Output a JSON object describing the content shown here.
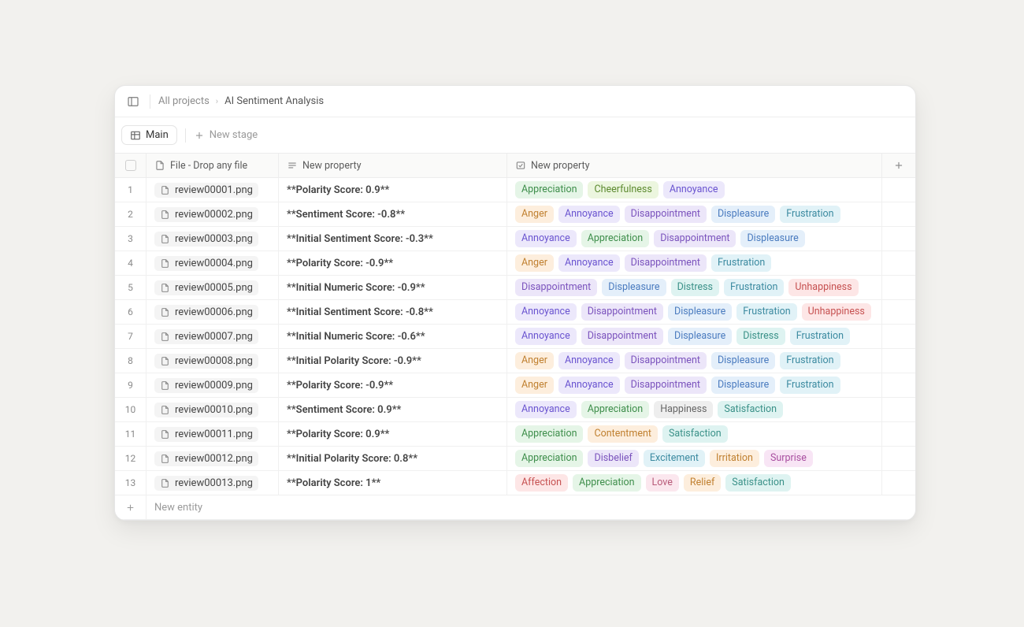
{
  "breadcrumbs": {
    "root": "All projects",
    "current": "AI Sentiment Analysis"
  },
  "stages": {
    "main_tab": "Main",
    "new_stage": "New stage"
  },
  "columns": {
    "file": "File - Drop any file",
    "prop1": "New property",
    "prop2": "New property"
  },
  "new_entity_label": "New entity",
  "tag_palette": {
    "Appreciation": "c-green",
    "Cheerfulness": "c-lime",
    "Annoyance": "c-purple",
    "Anger": "c-orange",
    "Disappointment": "c-violet",
    "Displeasure": "c-blue",
    "Frustration": "c-cyan",
    "Distress": "c-teal",
    "Unhappiness": "c-red",
    "Happiness": "c-gray",
    "Satisfaction": "c-teal",
    "Contentment": "c-orange",
    "Disbelief": "c-violet",
    "Excitement": "c-cyan",
    "Irritation": "c-orange",
    "Surprise": "c-magenta",
    "Affection": "c-red",
    "Love": "c-pink",
    "Relief": "c-orange"
  },
  "rows": [
    {
      "idx": 1,
      "file": "review00001.png",
      "score": "**Polarity Score: 0.9**",
      "tags": [
        "Appreciation",
        "Cheerfulness",
        "Annoyance"
      ]
    },
    {
      "idx": 2,
      "file": "review00002.png",
      "score": "**Sentiment Score: -0.8**",
      "tags": [
        "Anger",
        "Annoyance",
        "Disappointment",
        "Displeasure",
        "Frustration"
      ]
    },
    {
      "idx": 3,
      "file": "review00003.png",
      "score": "**Initial Sentiment Score: -0.3**",
      "tags": [
        "Annoyance",
        "Appreciation",
        "Disappointment",
        "Displeasure"
      ]
    },
    {
      "idx": 4,
      "file": "review00004.png",
      "score": "**Polarity Score: -0.9**",
      "tags": [
        "Anger",
        "Annoyance",
        "Disappointment",
        "Frustration"
      ]
    },
    {
      "idx": 5,
      "file": "review00005.png",
      "score": "**Initial Numeric Score: -0.9**",
      "tags": [
        "Disappointment",
        "Displeasure",
        "Distress",
        "Frustration",
        "Unhappiness"
      ]
    },
    {
      "idx": 6,
      "file": "review00006.png",
      "score": "**Initial Sentiment Score: -0.8**",
      "tags": [
        "Annoyance",
        "Disappointment",
        "Displeasure",
        "Frustration",
        "Unhappiness"
      ]
    },
    {
      "idx": 7,
      "file": "review00007.png",
      "score": "**Initial Numeric Score: -0.6**",
      "tags": [
        "Annoyance",
        "Disappointment",
        "Displeasure",
        "Distress",
        "Frustration"
      ]
    },
    {
      "idx": 8,
      "file": "review00008.png",
      "score": "**Initial Polarity Score: -0.9**",
      "tags": [
        "Anger",
        "Annoyance",
        "Disappointment",
        "Displeasure",
        "Frustration"
      ]
    },
    {
      "idx": 9,
      "file": "review00009.png",
      "score": "**Polarity Score: -0.9**",
      "tags": [
        "Anger",
        "Annoyance",
        "Disappointment",
        "Displeasure",
        "Frustration"
      ]
    },
    {
      "idx": 10,
      "file": "review00010.png",
      "score": "**Sentiment Score: 0.9**",
      "tags": [
        "Annoyance",
        "Appreciation",
        "Happiness",
        "Satisfaction"
      ]
    },
    {
      "idx": 11,
      "file": "review00011.png",
      "score": "**Polarity Score: 0.9**",
      "tags": [
        "Appreciation",
        "Contentment",
        "Satisfaction"
      ]
    },
    {
      "idx": 12,
      "file": "review00012.png",
      "score": "**Initial Polarity Score: 0.8**",
      "tags": [
        "Appreciation",
        "Disbelief",
        "Excitement",
        "Irritation",
        "Surprise"
      ]
    },
    {
      "idx": 13,
      "file": "review00013.png",
      "score": "**Polarity Score: 1**",
      "tags": [
        "Affection",
        "Appreciation",
        "Love",
        "Relief",
        "Satisfaction"
      ]
    }
  ]
}
